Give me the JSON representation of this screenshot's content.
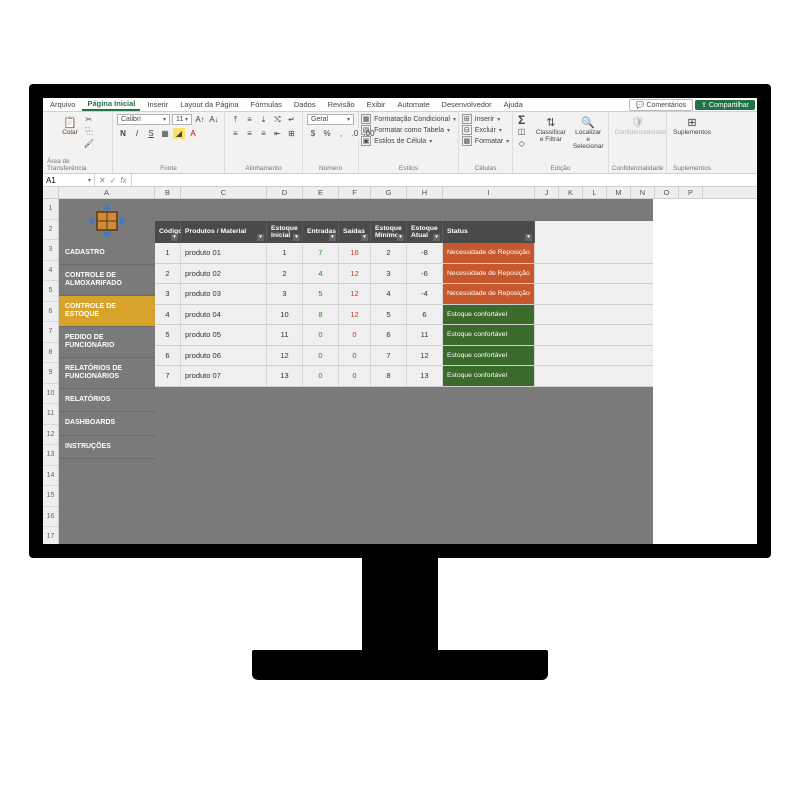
{
  "tabs": {
    "items": [
      "Arquivo",
      "Página Inicial",
      "Inserir",
      "Layout da Página",
      "Fórmulas",
      "Dados",
      "Revisão",
      "Exibir",
      "Automate",
      "Desenvolvedor",
      "Ajuda"
    ],
    "active_index": 1,
    "comments": "Comentários",
    "share": "Compartilhar"
  },
  "ribbon": {
    "clipboard": {
      "paste": "Colar",
      "label": "Área de Transferência"
    },
    "font": {
      "name": "Calibri",
      "size": "11",
      "label": "Fonte"
    },
    "alignment": {
      "label": "Alinhamento"
    },
    "number": {
      "format": "Geral",
      "label": "Número"
    },
    "styles": {
      "cond": "Formatação Condicional",
      "table": "Formatar como Tabela",
      "cell": "Estilos de Célula",
      "label": "Estilos"
    },
    "cells": {
      "insert": "Inserir",
      "delete": "Excluir",
      "format": "Formatar",
      "label": "Células"
    },
    "editing": {
      "sort": "Classificar e Filtrar",
      "find": "Localizar e Selecionar",
      "label": "Edição"
    },
    "sensitivity": {
      "btn": "Confidencialidade",
      "label": "Confidencialidade"
    },
    "addins": {
      "btn": "Suplementos",
      "label": "Suplementos"
    }
  },
  "formula_bar": {
    "cell": "A1",
    "value": ""
  },
  "columns": [
    "A",
    "B",
    "C",
    "D",
    "E",
    "F",
    "G",
    "H",
    "I",
    "J",
    "K",
    "L",
    "M",
    "N",
    "O",
    "P"
  ],
  "rownums": [
    "1",
    "2",
    "3",
    "4",
    "5",
    "6",
    "7",
    "8",
    "9",
    "10",
    "11",
    "12",
    "13",
    "14",
    "15",
    "16",
    "17"
  ],
  "sidemenu": {
    "items": [
      {
        "label": "CADASTRO"
      },
      {
        "label": "CONTROLE DE ALMOXARIFADO"
      },
      {
        "label": "CONTROLE DE ESTOQUE",
        "active": true
      },
      {
        "label": "PEDIDO DE FUNCIONÁRIO"
      },
      {
        "label": "RELATÓRIOS DE FUNCIONÁRIOS"
      },
      {
        "label": "RELATÓRIOS"
      },
      {
        "label": "DASHBOARDS"
      },
      {
        "label": "INSTRUÇÕES"
      }
    ]
  },
  "table": {
    "headers": {
      "codigo": "Código",
      "produto": "Produtos / Material",
      "est_ini": "Estoque Inicial",
      "entradas": "Entradas",
      "saidas": "Saídas",
      "est_min": "Estoque Mínimo",
      "est_atual": "Estoque Atual",
      "status": "Status"
    },
    "status_labels": {
      "warn": "Necessidade de Reposição",
      "ok": "Estoque confortável"
    },
    "rows": [
      {
        "codigo": "1",
        "produto": "produto 01",
        "est_ini": "1",
        "entradas": "7",
        "saidas": "16",
        "est_min": "2",
        "est_atual": "-8",
        "status": "warn"
      },
      {
        "codigo": "2",
        "produto": "produto 02",
        "est_ini": "2",
        "entradas": "4",
        "saidas": "12",
        "est_min": "3",
        "est_atual": "-6",
        "status": "warn"
      },
      {
        "codigo": "3",
        "produto": "produto 03",
        "est_ini": "3",
        "entradas": "5",
        "saidas": "12",
        "est_min": "4",
        "est_atual": "-4",
        "status": "warn"
      },
      {
        "codigo": "4",
        "produto": "produto 04",
        "est_ini": "10",
        "entradas": "8",
        "saidas": "12",
        "est_min": "5",
        "est_atual": "6",
        "status": "ok"
      },
      {
        "codigo": "5",
        "produto": "produto 05",
        "est_ini": "11",
        "entradas": "0",
        "saidas": "0",
        "est_min": "6",
        "est_atual": "11",
        "status": "ok"
      },
      {
        "codigo": "6",
        "produto": "produto 06",
        "est_ini": "12",
        "entradas": "0",
        "saidas": "0",
        "est_min": "7",
        "est_atual": "12",
        "status": "ok"
      },
      {
        "codigo": "7",
        "produto": "produto 07",
        "est_ini": "13",
        "entradas": "0",
        "saidas": "0",
        "est_min": "8",
        "est_atual": "13",
        "status": "ok"
      }
    ]
  }
}
